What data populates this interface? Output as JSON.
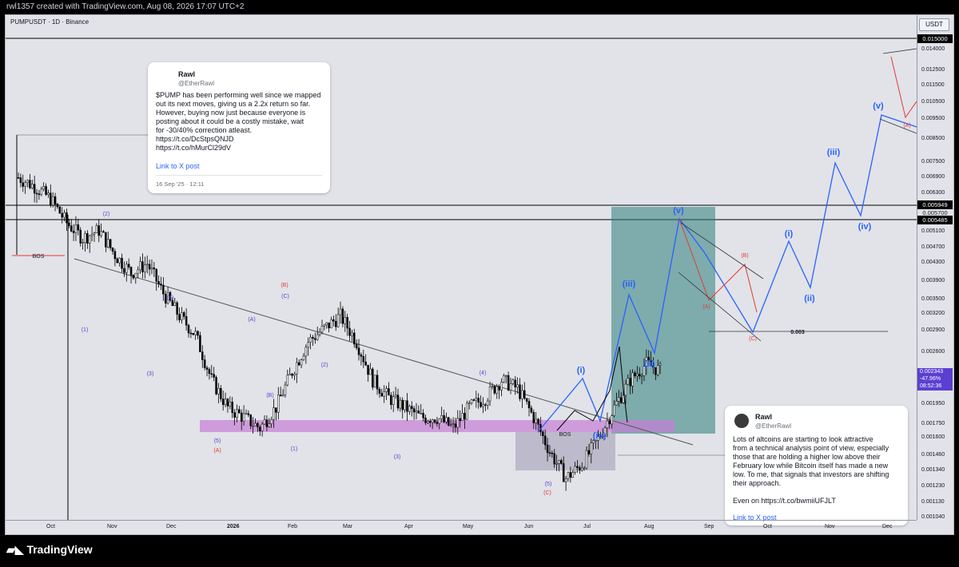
{
  "header": {
    "created_text": "rwl1357 created with TradingView.com, Aug 08, 2026 17:07 UTC+2"
  },
  "symbol": {
    "title": "PUMPUSDT · 1D · Binance"
  },
  "axis": {
    "currency": "USDT",
    "price_ticks": [
      "0.015000",
      "0.014000",
      "0.012500",
      "0.011500",
      "0.010500",
      "0.009500",
      "0.008500",
      "0.007500",
      "0.006900",
      "0.006300",
      "0.005949",
      "0.005700",
      "0.005485",
      "0.005100",
      "0.004700",
      "0.004300",
      "0.003900",
      "0.003500",
      "0.003200",
      "0.002900",
      "0.002600",
      "0.002343",
      "0.001950",
      "0.001750",
      "0.001600",
      "0.001460",
      "0.001340",
      "0.001230",
      "0.001130",
      "0.001040"
    ],
    "time_ticks": [
      "Oct",
      "Nov",
      "Dec",
      "2026",
      "Feb",
      "Mar",
      "Apr",
      "May",
      "Jun",
      "Jul",
      "Aug",
      "Sep",
      "Oct",
      "Nov",
      "Dec"
    ]
  },
  "price_labels": {
    "top": "0.015000",
    "upper": "0.005949",
    "upper_mid": "0.005700",
    "lower": "0.005485",
    "current_price": "0.002343",
    "current_change": "-47.96%",
    "current_countdown": "08:52:36"
  },
  "annotations": {
    "bos_left": "BOS",
    "bos_right": "BOS",
    "target_level": "0.003",
    "wave_purple": [
      "(2)",
      "(1)",
      "(4)",
      "(3)",
      "(5)",
      "(2)",
      "(1)",
      "(A)",
      "(B)",
      "(C)",
      "(3)",
      "(4)",
      "(5)"
    ],
    "wave_red": [
      "(A)",
      "(B)",
      "(C)",
      "(A)",
      "(B)",
      "(C)",
      "(A)"
    ],
    "wave_blue": [
      "(i)",
      "(ii)",
      "(iii)",
      "(iv)",
      "(v)",
      "(i)",
      "(ii)",
      "(iii)",
      "(iv)",
      "(v)"
    ]
  },
  "tweet1": {
    "name": "Rawl",
    "handle": "@EtherRawl",
    "body": "$PUMP has been performing well since we mapped\nout its next moves, giving us a 2.2x return so far.\nHowever, buying now just because everyone is\nposting about it could be a costly mistake, wait\nfor -30/40% correction atleast.\nhttps://t.co/DcStpsQNJD\nhttps://t.co/hMurCl29dV",
    "link": "Link to X post",
    "date": "16 Sep '25 · 12:11"
  },
  "tweet2": {
    "name": "Rawl",
    "handle": "@EtherRawl",
    "body": "Lots of altcoins are starting to look attractive\nfrom a technical analysis point of view, especially\nthose that are holding a higher low above their\nFebruary low while Bitcoin itself has made a new\nlow. To me, that signals that investors are shifting\ntheir approach.\n\nEven on https://t.co/bwmiiUFJLT",
    "link": "Link to X post"
  },
  "footer": {
    "brand": "TradingView"
  },
  "colors": {
    "blue_wave": "#2962ff",
    "red_wave": "#e53935",
    "purple_wave": "#5b3fd1",
    "zone_teal": "#2e7d7a",
    "zone_purple": "#c77dd6",
    "candle": "#000000"
  },
  "chart_data": {
    "type": "candlestick",
    "symbol": "PUMPUSDT",
    "interval": "1D",
    "exchange": "Binance",
    "x_range": [
      "Sep 2025",
      "Dec 2026"
    ],
    "ylim": [
      0.00104,
      0.0155
    ],
    "close_approx": [
      0.0065,
      0.0062,
      0.0058,
      0.0051,
      0.0047,
      0.0049,
      0.0043,
      0.0039,
      0.0041,
      0.0035,
      0.0031,
      0.0028,
      0.0022,
      0.0019,
      0.0018,
      0.0017,
      0.0019,
      0.0023,
      0.0027,
      0.0029,
      0.0031,
      0.0027,
      0.0022,
      0.002,
      0.0019,
      0.0018,
      0.0018,
      0.0017,
      0.0019,
      0.002,
      0.0022,
      0.0021,
      0.0018,
      0.0015,
      0.0013,
      0.0014,
      0.0016,
      0.0019,
      0.0022,
      0.0024,
      0.0023
    ],
    "current_price": 0.002343,
    "change_pct": -47.96
  }
}
